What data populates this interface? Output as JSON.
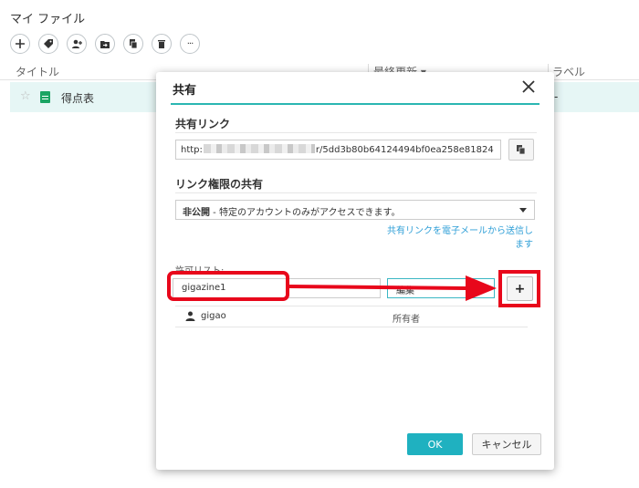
{
  "page": {
    "title": "マイ ファイル"
  },
  "toolbar": {
    "buttons": [
      {
        "name": "add-icon",
        "glyph": "+"
      },
      {
        "name": "tag-icon"
      },
      {
        "name": "add-user-icon"
      },
      {
        "name": "move-folder-icon"
      },
      {
        "name": "copy-icon"
      },
      {
        "name": "trash-icon"
      },
      {
        "name": "more-icon",
        "glyph": "···"
      }
    ]
  },
  "list": {
    "columns": {
      "title": "タイトル",
      "updated": "最終更新 ▾",
      "label": "ラベル"
    },
    "rows": [
      {
        "name": "得点表",
        "label": "-"
      }
    ]
  },
  "dialog": {
    "title": "共有",
    "share_link_label": "共有リンク",
    "share_link_prefix": "http:",
    "share_link_suffix": "r/5dd3b80b64124494bf0ea258e81824",
    "permission_label": "リンク権限の共有",
    "permission_value_bold": "非公開",
    "permission_value_rest": " - 特定のアカウントのみがアクセスできます。",
    "email_link": "共有リンクを電子メールから送信します",
    "allow_list_label": "許可リスト:",
    "user_input_value": "gigazine1",
    "role_value": "編集",
    "owner": {
      "user": "gigao",
      "role": "所有者"
    },
    "ok_label": "OK",
    "cancel_label": "キャンセル"
  },
  "colors": {
    "accent": "#1fb1c0",
    "annotation": "#e8071b",
    "link": "#2f9fd7",
    "row_highlight": "#e6f6f5"
  }
}
